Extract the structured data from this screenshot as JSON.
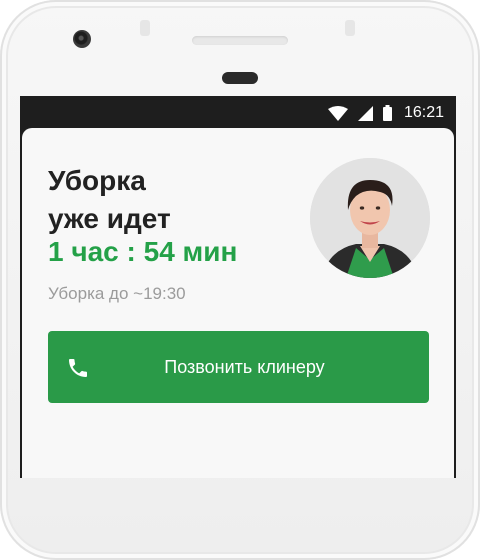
{
  "status_bar": {
    "time": "16:21",
    "icons": [
      "wifi-icon",
      "signal-icon",
      "battery-icon"
    ]
  },
  "cleaning": {
    "title_line1": "Уборка",
    "title_line2": "уже идет",
    "timer": "1 час : 54 мин",
    "until": "Уборка до ~19:30"
  },
  "actions": {
    "call_label": "Позвонить клинеру",
    "call_icon": "phone-icon"
  },
  "colors": {
    "accent_green": "#24a148",
    "button_green": "#2a9a48",
    "text_dark": "#222222",
    "text_muted": "#9b9b9b"
  }
}
